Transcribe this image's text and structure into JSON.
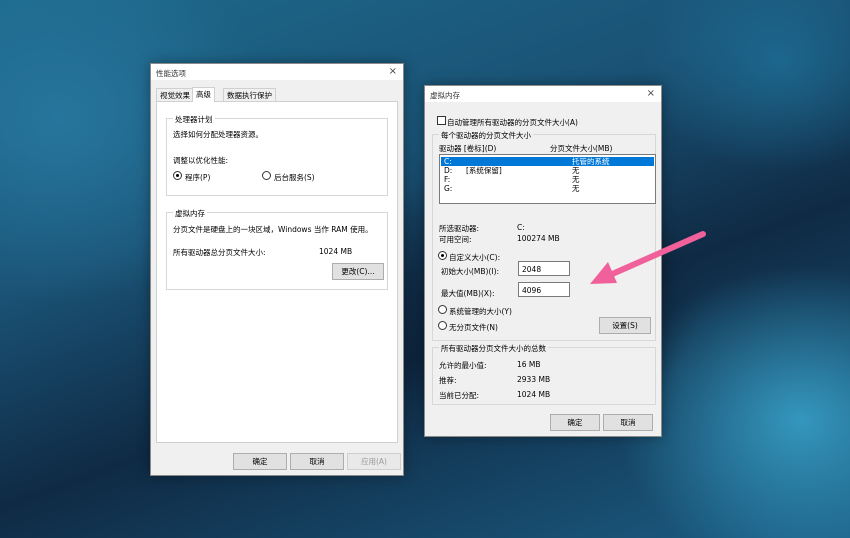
{
  "perf_dialog": {
    "title": "性能选项",
    "close_glyph": "×",
    "tabs": [
      "视觉效果",
      "高级",
      "数据执行保护"
    ],
    "processor_group": {
      "legend": "处理器计划",
      "desc": "选择如何分配处理器资源。",
      "adjust_label": "调整以优化性能:",
      "option_programs": "程序(P)",
      "option_background": "后台服务(S)"
    },
    "vm_group": {
      "legend": "虚拟内存",
      "desc": "分页文件是硬盘上的一块区域，Windows 当作 RAM 使用。",
      "total_label": "所有驱动器总分页文件大小:",
      "total_value": "1024 MB",
      "change_button": "更改(C)..."
    },
    "buttons": {
      "ok": "确定",
      "cancel": "取消",
      "apply": "应用(A)"
    }
  },
  "vm_dialog": {
    "title": "虚拟内存",
    "close_glyph": "×",
    "auto_manage_label": "自动管理所有驱动器的分页文件大小(A)",
    "drives_group": {
      "legend": "每个驱动器的分页文件大小",
      "col_drive": "驱动器 [卷标](D)",
      "col_size": "分页文件大小(MB)",
      "rows": [
        {
          "drive": "C:",
          "label": "",
          "size": "托管的系统"
        },
        {
          "drive": "D:",
          "label": "[系统保留]",
          "size": "无"
        },
        {
          "drive": "F:",
          "label": "",
          "size": "无"
        },
        {
          "drive": "G:",
          "label": "",
          "size": "无"
        }
      ]
    },
    "selected_drive_label": "所选驱动器:",
    "selected_drive_value": "C:",
    "free_space_label": "可用空间:",
    "free_space_value": "100274 MB",
    "custom_size_label": "自定义大小(C):",
    "initial_size_label": "初始大小(MB)(I):",
    "initial_size_value": "2048",
    "max_size_label": "最大值(MB)(X):",
    "max_size_value": "4096",
    "system_managed_label": "系统管理的大小(Y)",
    "no_paging_label": "无分页文件(N)",
    "set_button": "设置(S)",
    "totals_group": {
      "legend": "所有驱动器分页文件大小的总数",
      "min_label": "允许的最小值:",
      "min_value": "16 MB",
      "recommended_label": "推荐:",
      "recommended_value": "2933 MB",
      "current_label": "当前已分配:",
      "current_value": "1024 MB"
    },
    "buttons": {
      "ok": "确定",
      "cancel": "取消"
    }
  },
  "annotation": {
    "arrow_color": "#f0609a"
  }
}
